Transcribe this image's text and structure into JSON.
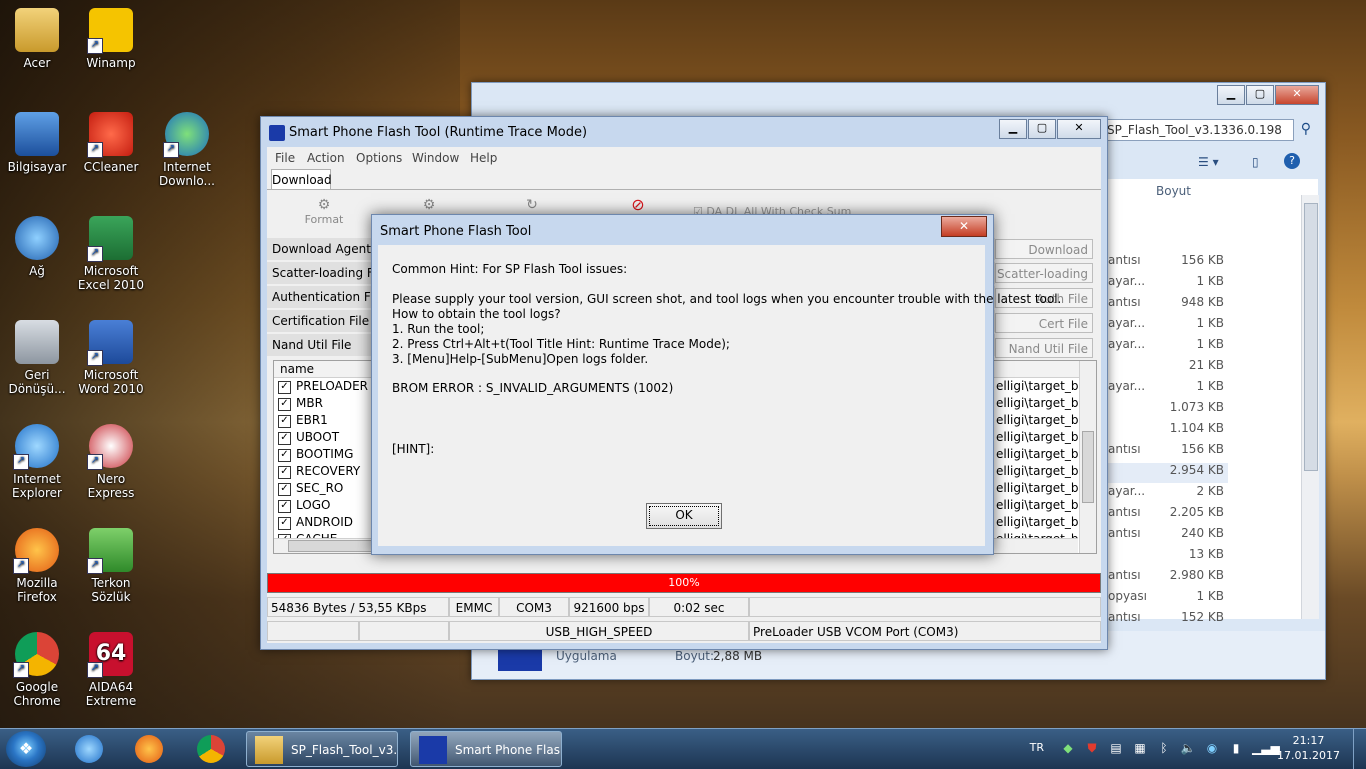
{
  "desktop": {
    "icons": [
      {
        "label": "Acer"
      },
      {
        "label": "Winamp"
      },
      {
        "label": "Bilgisayar"
      },
      {
        "label": "CCleaner"
      },
      {
        "label": "Internet Downlo..."
      },
      {
        "label": "Ağ"
      },
      {
        "label": "Microsoft Excel 2010"
      },
      {
        "label": "Geri Dönüşü..."
      },
      {
        "label": "Microsoft Word 2010"
      },
      {
        "label": "Internet Explorer"
      },
      {
        "label": "Nero Express"
      },
      {
        "label": "Mozilla Firefox"
      },
      {
        "label": "Terkon Sözlük"
      },
      {
        "label": "Google Chrome"
      },
      {
        "label": "AIDA64 Extreme"
      }
    ]
  },
  "explorer": {
    "address": "SP_Flash_Tool_v3.1336.0.198",
    "column_header": "Boyut",
    "rows": [
      {
        "name": "antısı",
        "size": "156 KB"
      },
      {
        "name": "ayar...",
        "size": "1 KB"
      },
      {
        "name": "antısı",
        "size": "948 KB"
      },
      {
        "name": "ayar...",
        "size": "1 KB"
      },
      {
        "name": "ayar...",
        "size": "1 KB"
      },
      {
        "name": "",
        "size": "21 KB"
      },
      {
        "name": "ayar...",
        "size": "1 KB"
      },
      {
        "name": "",
        "size": "1.073 KB"
      },
      {
        "name": "",
        "size": "1.104 KB"
      },
      {
        "name": "antısı",
        "size": "156 KB"
      },
      {
        "name": "",
        "size": "2.954 KB"
      },
      {
        "name": "ayar...",
        "size": "2 KB"
      },
      {
        "name": "antısı",
        "size": "2.205 KB"
      },
      {
        "name": "antısı",
        "size": "240 KB"
      },
      {
        "name": "",
        "size": "13 KB"
      },
      {
        "name": "antısı",
        "size": "2.980 KB"
      },
      {
        "name": "opyası",
        "size": "1 KB"
      },
      {
        "name": "antısı",
        "size": "152 KB"
      }
    ],
    "details": {
      "type": "Uygulama",
      "size_label": "Boyut:",
      "size_value": "2,88 MB"
    }
  },
  "spflash": {
    "title": "Smart Phone Flash Tool (Runtime Trace Mode)",
    "menu": [
      "File",
      "Action",
      "Options",
      "Window",
      "Help"
    ],
    "tab": "Download",
    "toolbar": {
      "format": "Format",
      "da_check": "DA DL All With Check Sum"
    },
    "fields": [
      "Download Agent",
      "Scatter-loading File",
      "Authentication File",
      "Certification File",
      "Nand Util File"
    ],
    "right_buttons": [
      "Download Agent",
      "Scatter-loading",
      "Auth File",
      "Cert File",
      "Nand Util File"
    ],
    "table_header": "name",
    "partitions": [
      {
        "name": "PRELOADER",
        "path": "elligi\\target_bin\\p"
      },
      {
        "name": "MBR",
        "path": "elligi\\target_bin\\M"
      },
      {
        "name": "EBR1",
        "path": "elligi\\target_bin\\E"
      },
      {
        "name": "UBOOT",
        "path": "elligi\\target_bin\\lk"
      },
      {
        "name": "BOOTIMG",
        "path": "elligi\\target_bin\\b"
      },
      {
        "name": "RECOVERY",
        "path": "elligi\\target_bin\\re"
      },
      {
        "name": "SEC_RO",
        "path": "elligi\\target_bin\\s"
      },
      {
        "name": "LOGO",
        "path": "elligi\\target_bin\\lo"
      },
      {
        "name": "ANDROID",
        "path": "elligi\\target_bin\\s"
      },
      {
        "name": "CACHE",
        "path": "elligi\\target_bin\\c"
      }
    ],
    "progress": {
      "label": "100%",
      "fraction": 1.0,
      "color": "#ff0000"
    },
    "status": {
      "speed": "54836 Bytes / 53,55 KBps",
      "storage": "EMMC",
      "port": "COM3",
      "baud": "921600 bps",
      "time": "0:02 sec",
      "usb": "USB_HIGH_SPEED",
      "vcom": "PreLoader USB VCOM Port (COM3)"
    }
  },
  "dialog": {
    "title": "Smart Phone Flash Tool",
    "close_label": "✕",
    "lines": [
      "Common Hint: For SP Flash Tool issues:",
      "Please supply your tool version, GUI screen shot, and tool logs when you encounter trouble with the latest tool.",
      "How to obtain the tool logs?",
      "1. Run the tool;",
      "2. Press Ctrl+Alt+t(Tool Title Hint: Runtime Trace Mode);",
      "3. [Menu]Help-[SubMenu]Open logs folder.",
      "BROM ERROR : S_INVALID_ARGUMENTS (1002)",
      "[HINT]:"
    ],
    "ok": "OK"
  },
  "taskbar": {
    "tasks": [
      {
        "label": "SP_Flash_Tool_v3...."
      },
      {
        "label": "Smart Phone Flas..."
      }
    ],
    "lang": "TR",
    "time": "21:17",
    "date": "17.01.2017"
  }
}
